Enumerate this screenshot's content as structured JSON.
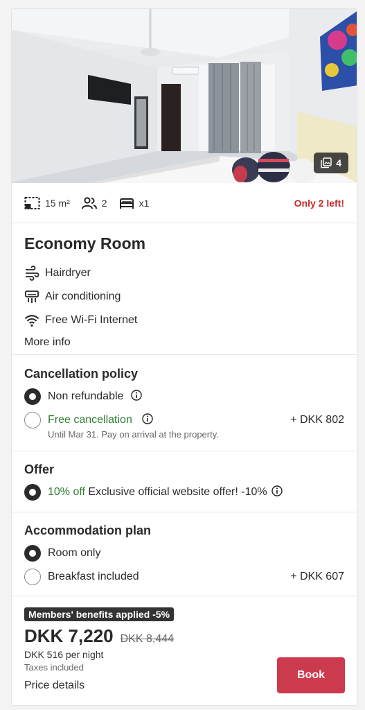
{
  "photo": {
    "count": "4",
    "icon": "gallery-icon"
  },
  "specs": {
    "area": "15 m²",
    "guests": "2",
    "beds": "x1",
    "scarcity": "Only 2 left!"
  },
  "room": {
    "title": "Economy Room",
    "amenities": [
      {
        "icon": "hairdryer-icon",
        "label": "Hairdryer"
      },
      {
        "icon": "air-conditioning-icon",
        "label": "Air conditioning"
      },
      {
        "icon": "wifi-icon",
        "label": "Free Wi-Fi Internet"
      }
    ],
    "more_info": "More info"
  },
  "cancellation": {
    "title": "Cancellation policy",
    "options": [
      {
        "label": "Non refundable",
        "selected": true
      },
      {
        "label": "Free cancellation",
        "price": "+ DKK 802",
        "note": "Until Mar 31. Pay on arrival at the property.",
        "selected": false
      }
    ]
  },
  "offer": {
    "title": "Offer",
    "discount": "10% off",
    "text": "Exclusive official website offer! -10%"
  },
  "plan": {
    "title": "Accommodation plan",
    "options": [
      {
        "label": "Room only",
        "selected": true
      },
      {
        "label": "Breakfast included",
        "price": "+ DKK 607",
        "selected": false
      }
    ]
  },
  "footer": {
    "badge": "Members' benefits applied -5%",
    "price": "DKK 7,220",
    "old_price": "DKK 8,444",
    "per_night": "DKK 516 per night",
    "taxes": "Taxes included",
    "price_details": "Price details",
    "book": "Book"
  },
  "colors": {
    "accent": "#cc3a4e",
    "scarcity": "#c62828",
    "green": "#2e7d32",
    "dark": "#2b2b2b"
  }
}
